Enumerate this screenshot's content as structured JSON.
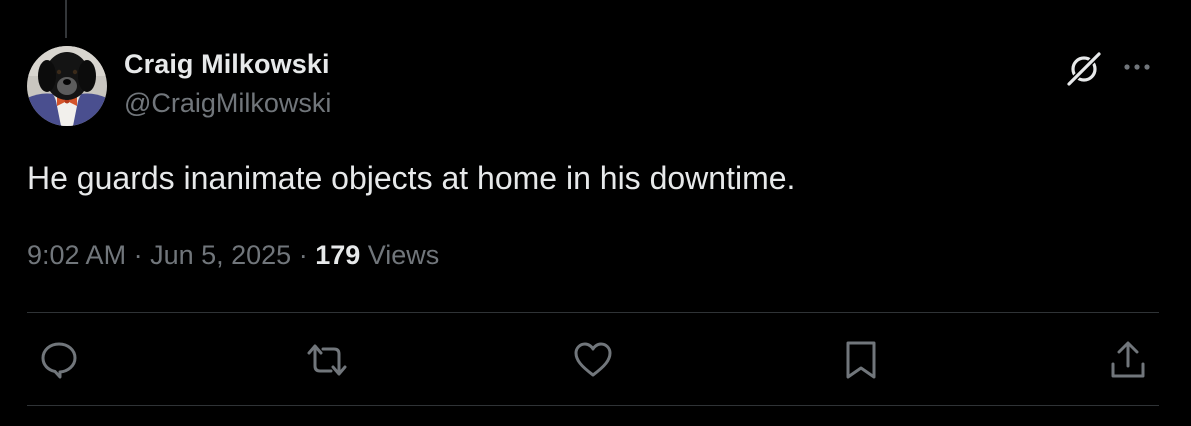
{
  "author": {
    "display_name": "Craig Milkowski",
    "handle": "@CraigMilkowski",
    "avatar_icon": "dog-avatar"
  },
  "tweet": {
    "text": "He guards inanimate objects at home in his downtime."
  },
  "meta": {
    "time": "9:02 AM",
    "separator1": " · ",
    "date": "Jun 5, 2025",
    "separator2": " · ",
    "views_count": "179",
    "views_label": " Views"
  },
  "header_actions": {
    "grok_icon": "grok-icon",
    "more_icon": "more-icon"
  },
  "actions": [
    {
      "name": "reply",
      "icon": "reply-icon"
    },
    {
      "name": "retweet",
      "icon": "retweet-icon"
    },
    {
      "name": "like",
      "icon": "like-icon"
    },
    {
      "name": "bookmark",
      "icon": "bookmark-icon"
    },
    {
      "name": "share",
      "icon": "share-icon"
    }
  ],
  "colors": {
    "background": "#000000",
    "primary_text": "#e7e9ea",
    "secondary_text": "#71767b",
    "divider": "#2f3336"
  }
}
